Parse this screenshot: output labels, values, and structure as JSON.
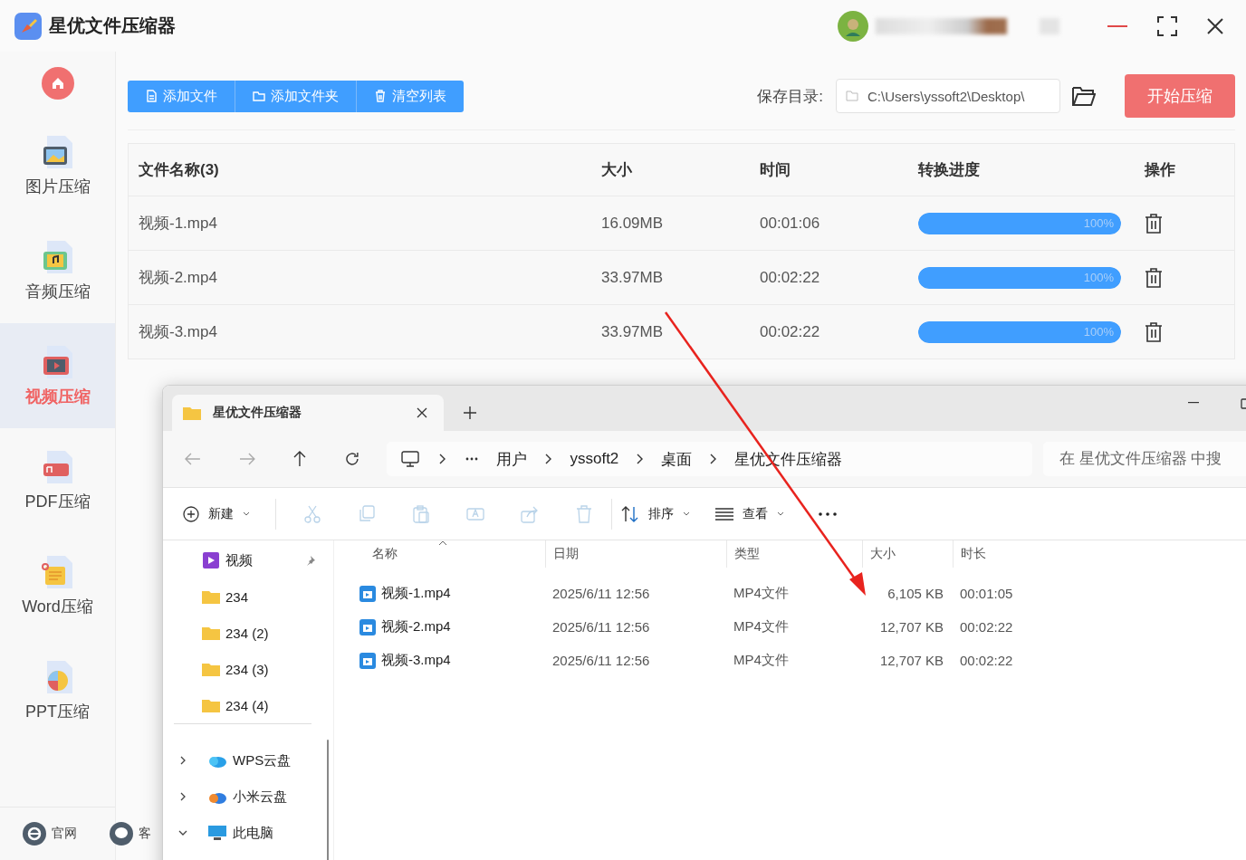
{
  "app": {
    "title": "星优文件压缩器"
  },
  "sidebar": {
    "items": [
      {
        "label": "图片压缩",
        "kind": "image",
        "selected": false
      },
      {
        "label": "音频压缩",
        "kind": "audio",
        "selected": false
      },
      {
        "label": "视频压缩",
        "kind": "video",
        "selected": true
      },
      {
        "label": "PDF压缩",
        "kind": "pdf",
        "selected": false
      },
      {
        "label": "Word压缩",
        "kind": "word",
        "selected": false
      },
      {
        "label": "PPT压缩",
        "kind": "ppt",
        "selected": false
      }
    ],
    "footer": [
      {
        "label": "官网",
        "kind": "browser"
      },
      {
        "label": "客",
        "kind": "chat"
      }
    ]
  },
  "toolbar": {
    "buttons": [
      {
        "label": "添加文件",
        "kind": "file"
      },
      {
        "label": "添加文件夹",
        "kind": "folder"
      },
      {
        "label": "清空列表",
        "kind": "trash"
      }
    ],
    "save_label": "保存目录:",
    "save_path": "C:\\Users\\yssoft2\\Desktop\\",
    "start_button": "开始压缩"
  },
  "table": {
    "columns": [
      "文件名称(3)",
      "大小",
      "时间",
      "转换进度",
      "操作"
    ],
    "rows": [
      {
        "name": "视频-1.mp4",
        "size": "16.09MB",
        "time": "00:01:06",
        "level": 1,
        "reading": "100%"
      },
      {
        "name": "视频-2.mp4",
        "size": "33.97MB",
        "time": "00:02:22",
        "level": 1,
        "reading": "100%"
      },
      {
        "name": "视频-3.mp4",
        "size": "33.97MB",
        "time": "00:02:22",
        "level": 1,
        "reading": "100%"
      }
    ]
  },
  "explorer": {
    "tab_title": "星优文件压缩器",
    "path": [
      "用户",
      "yssoft2",
      "桌面",
      "星优文件压缩器"
    ],
    "search_placeholder": "在 星优文件压缩器 中搜",
    "new_label": "新建",
    "actions": [
      {
        "kind": "cut",
        "disabled": true
      },
      {
        "kind": "copy",
        "disabled": true
      },
      {
        "kind": "paste",
        "disabled": true
      },
      {
        "kind": "rename",
        "disabled": true
      },
      {
        "kind": "share",
        "disabled": true
      },
      {
        "kind": "delete",
        "disabled": true
      }
    ],
    "sort_label": "排序",
    "view_label": "查看",
    "quick_access": [
      {
        "label": "视频",
        "kind": "video",
        "pinned": true
      },
      {
        "label": "234",
        "kind": "folder",
        "pinned": false
      },
      {
        "label": "234 (2)",
        "kind": "folder",
        "pinned": false
      },
      {
        "label": "234 (3)",
        "kind": "folder",
        "pinned": false
      },
      {
        "label": "234 (4)",
        "kind": "folder",
        "pinned": false
      }
    ],
    "locations": [
      {
        "label": "WPS云盘",
        "kind": "wps",
        "expanded": false
      },
      {
        "label": "小米云盘",
        "kind": "mi",
        "expanded": false
      },
      {
        "label": "此电脑",
        "kind": "pc",
        "expanded": true
      }
    ],
    "columns": [
      "名称",
      "日期",
      "类型",
      "大小",
      "时长"
    ],
    "rows": [
      {
        "name": "视频-1.mp4",
        "date": "2025/6/11 12:56",
        "type": "MP4文件",
        "size": "6,105 KB",
        "duration": "00:01:05"
      },
      {
        "name": "视频-2.mp4",
        "date": "2025/6/11 12:56",
        "type": "MP4文件",
        "size": "12,707 KB",
        "duration": "00:02:22"
      },
      {
        "name": "视频-3.mp4",
        "date": "2025/6/11 12:56",
        "type": "MP4文件",
        "size": "12,707 KB",
        "duration": "00:02:22"
      }
    ]
  }
}
